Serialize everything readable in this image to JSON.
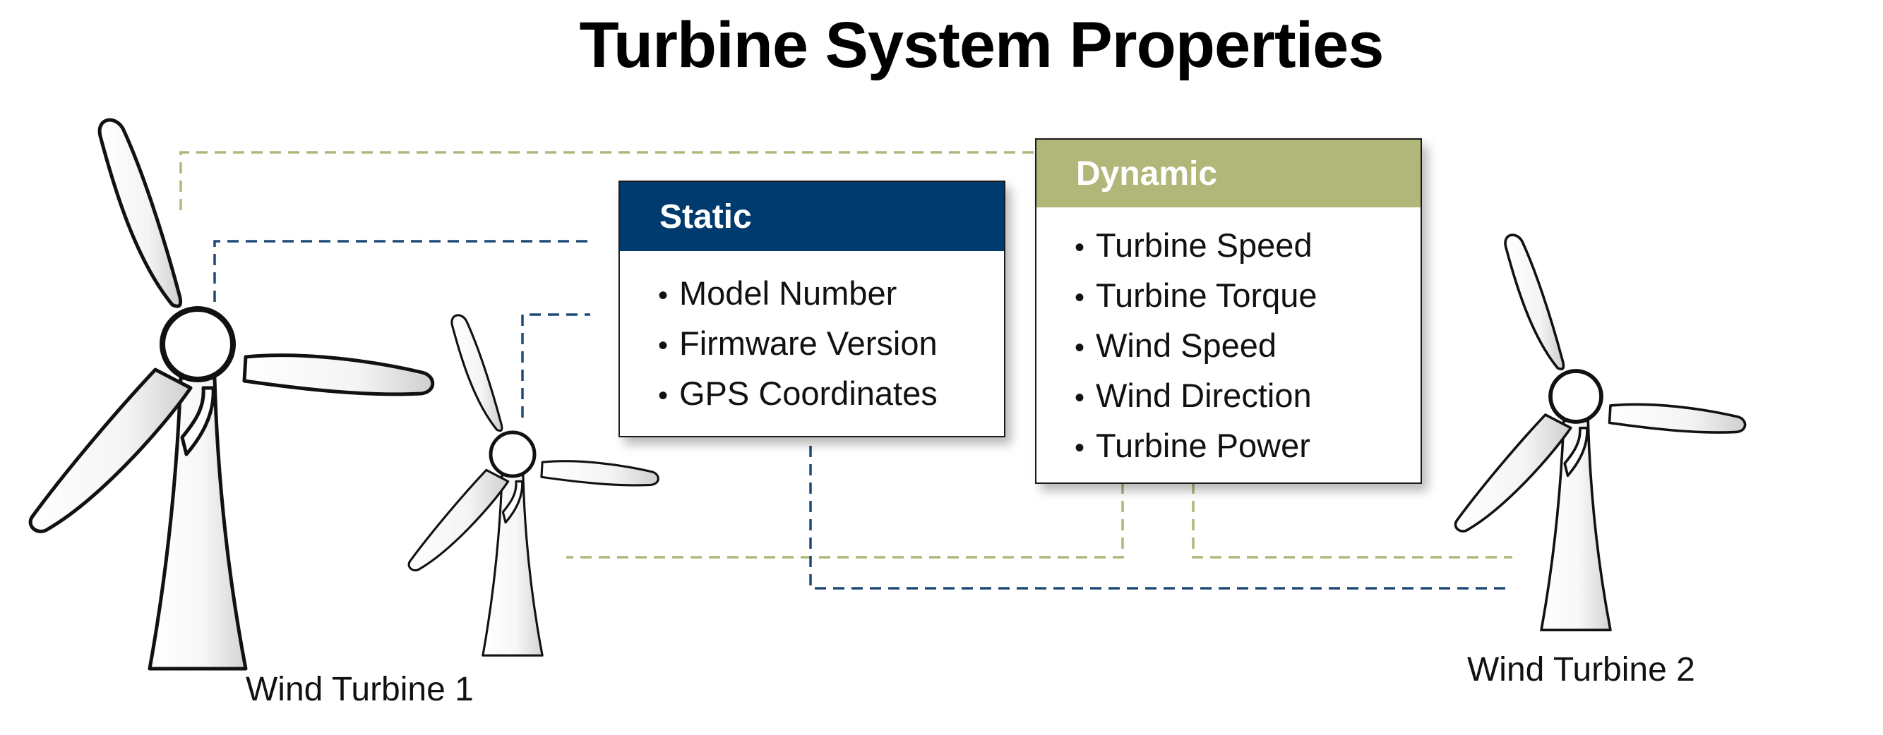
{
  "title": "Turbine System Properties",
  "colors": {
    "static_header": "#003b6f",
    "dynamic_header": "#b1b679",
    "static_connector": "#1f4a78",
    "dynamic_connector": "#b1b679",
    "turbine_outline": "#111111"
  },
  "static_card": {
    "header": "Static",
    "items": [
      "Model Number",
      "Firmware Version",
      "GPS Coordinates"
    ]
  },
  "dynamic_card": {
    "header": "Dynamic",
    "items": [
      "Turbine Speed",
      "Turbine Torque",
      "Wind Speed",
      "Wind Direction",
      "Turbine Power"
    ]
  },
  "turbines": [
    {
      "label": "Wind Turbine 1"
    },
    {
      "label": "Wind Turbine 2"
    }
  ],
  "bullet": "•"
}
